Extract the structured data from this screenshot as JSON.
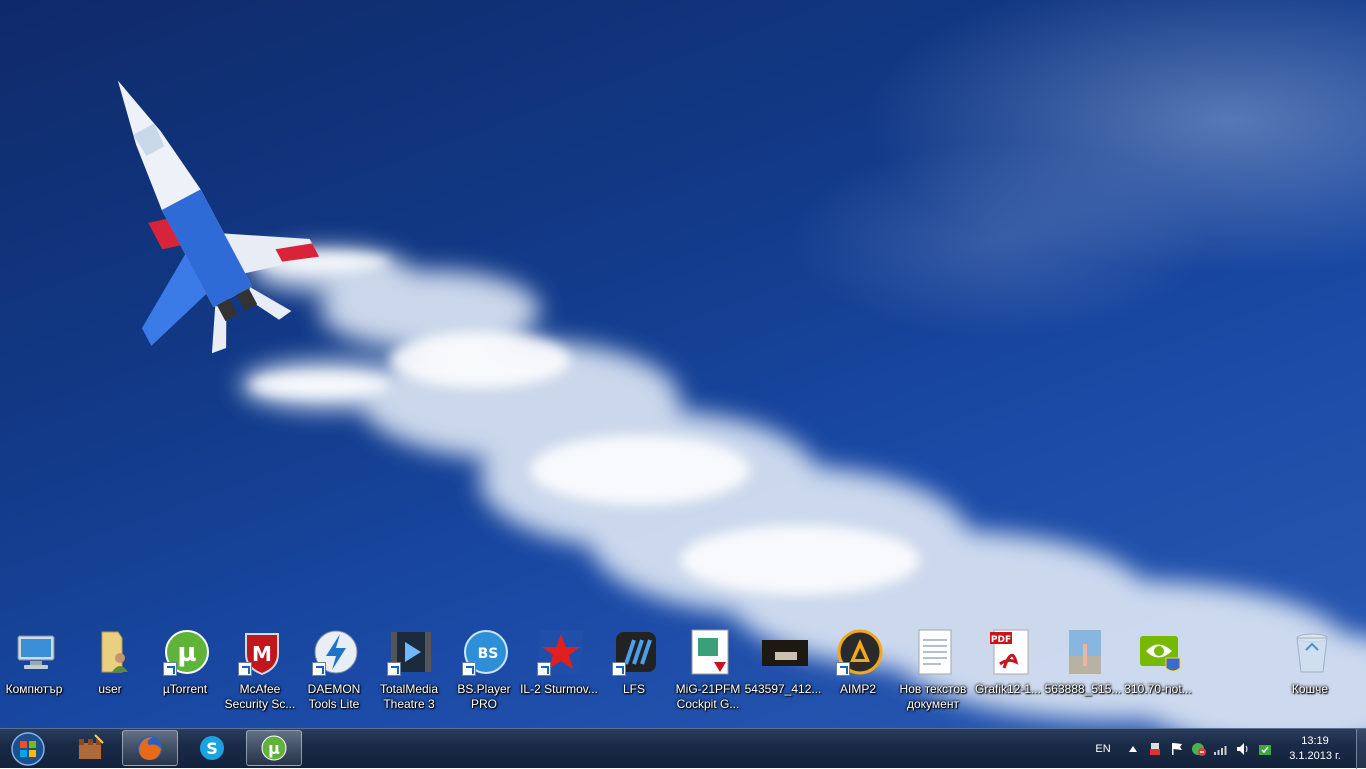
{
  "desktop": {
    "icons": [
      {
        "label": "Компютър",
        "icon": "computer-icon"
      },
      {
        "label": "user",
        "icon": "user-folder-icon"
      },
      {
        "label": "µTorrent",
        "icon": "utorrent-icon"
      },
      {
        "label": "McAfee Security Sc...",
        "icon": "mcafee-icon"
      },
      {
        "label": "DAEMON Tools Lite",
        "icon": "daemon-tools-icon"
      },
      {
        "label": "TotalMedia Theatre 3",
        "icon": "totalmedia-icon"
      },
      {
        "label": "BS.Player PRO",
        "icon": "bsplayer-icon"
      },
      {
        "label": "IL-2 Sturmov...",
        "icon": "il2-icon"
      },
      {
        "label": "LFS",
        "icon": "lfs-icon"
      },
      {
        "label": "MiG-21PFM Cockpit G...",
        "icon": "pdf-document-icon"
      },
      {
        "label": "543597_412...",
        "icon": "photo-thumbnail-icon"
      },
      {
        "label": "AIMP2",
        "icon": "aimp-icon"
      },
      {
        "label": "Нов текстов документ",
        "icon": "text-document-icon"
      },
      {
        "label": "Grafik12-1...",
        "icon": "adobe-pdf-icon"
      },
      {
        "label": "563888_515...",
        "icon": "photo-thumbnail-icon"
      },
      {
        "label": "310.70-not...",
        "icon": "nvidia-installer-icon"
      },
      {
        "label": "Кошче",
        "icon": "recycle-bin-icon"
      }
    ]
  },
  "taskbar": {
    "start_icon": "windows-orb-icon",
    "pinned": [
      {
        "name": "game-app",
        "icon": "castle-game-icon",
        "active": false
      },
      {
        "name": "firefox",
        "icon": "firefox-icon",
        "active": true
      },
      {
        "name": "skype",
        "icon": "skype-icon",
        "active": false
      },
      {
        "name": "utorrent",
        "icon": "utorrent-icon",
        "active": true
      }
    ],
    "tray": {
      "language": "EN",
      "icons": [
        "show-hidden-icons-icon",
        "usb-icon",
        "action-center-flag-icon",
        "antivirus-icon",
        "network-signal-icon",
        "volume-icon",
        "update-icon"
      ],
      "time": "13:19",
      "date": "3.1.2013 г."
    }
  },
  "colors": {
    "sky": "#123b8a",
    "taskbar": "#1a2b47"
  }
}
